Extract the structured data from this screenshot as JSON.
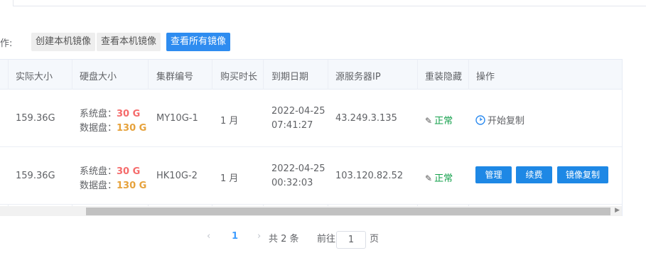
{
  "toolbar": {
    "ops_label": "作:",
    "create_image": "创建本机镜像",
    "view_image": "查看本机镜像",
    "view_all_images": "查看所有镜像"
  },
  "table": {
    "headers": [
      "实际大小",
      "硬盘大小",
      "集群编号",
      "购买时长",
      "到期日期",
      "源服务器IP",
      "重装隐藏",
      "操作"
    ],
    "rows": [
      {
        "actual_size": "159.36G",
        "sys_disk_label": "系统盘：",
        "sys_disk_value": "30 G",
        "data_disk_label": "数据盘：",
        "data_disk_value": "130 G",
        "cluster": "MY10G-1",
        "duration": "1 月",
        "expire_date": "2022-04-25",
        "expire_time": "07:41:27",
        "source_ip": "43.249.3.135",
        "reinstall_status": "正常",
        "op_copy": "开始复制"
      },
      {
        "actual_size": "159.36G",
        "sys_disk_label": "系统盘：",
        "sys_disk_value": "30 G",
        "data_disk_label": "数据盘：",
        "data_disk_value": "130 G",
        "cluster": "HK10G-2",
        "duration": "1 月",
        "expire_date": "2022-04-25",
        "expire_time": "00:32:03",
        "source_ip": "103.120.82.52",
        "reinstall_status": "正常",
        "op_manage": "管理",
        "op_renew": "续费",
        "op_image_copy": "镜像复制"
      }
    ]
  },
  "pagination": {
    "current_page": "1",
    "total": "共 2 条",
    "goto_label": "前往",
    "goto_value": "1",
    "page_unit": "页"
  },
  "colors": {
    "accent": "#2e8cf0",
    "danger": "#f56c6c",
    "warning": "#e6a23c",
    "success": "#13a04b"
  }
}
